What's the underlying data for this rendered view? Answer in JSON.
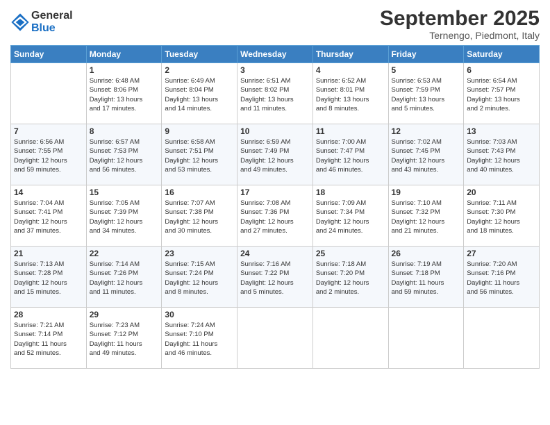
{
  "logo": {
    "general": "General",
    "blue": "Blue"
  },
  "header": {
    "month": "September 2025",
    "location": "Ternengo, Piedmont, Italy"
  },
  "weekdays": [
    "Sunday",
    "Monday",
    "Tuesday",
    "Wednesday",
    "Thursday",
    "Friday",
    "Saturday"
  ],
  "weeks": [
    [
      {
        "day": "",
        "info": ""
      },
      {
        "day": "1",
        "info": "Sunrise: 6:48 AM\nSunset: 8:06 PM\nDaylight: 13 hours\nand 17 minutes."
      },
      {
        "day": "2",
        "info": "Sunrise: 6:49 AM\nSunset: 8:04 PM\nDaylight: 13 hours\nand 14 minutes."
      },
      {
        "day": "3",
        "info": "Sunrise: 6:51 AM\nSunset: 8:02 PM\nDaylight: 13 hours\nand 11 minutes."
      },
      {
        "day": "4",
        "info": "Sunrise: 6:52 AM\nSunset: 8:01 PM\nDaylight: 13 hours\nand 8 minutes."
      },
      {
        "day": "5",
        "info": "Sunrise: 6:53 AM\nSunset: 7:59 PM\nDaylight: 13 hours\nand 5 minutes."
      },
      {
        "day": "6",
        "info": "Sunrise: 6:54 AM\nSunset: 7:57 PM\nDaylight: 13 hours\nand 2 minutes."
      }
    ],
    [
      {
        "day": "7",
        "info": "Sunrise: 6:56 AM\nSunset: 7:55 PM\nDaylight: 12 hours\nand 59 minutes."
      },
      {
        "day": "8",
        "info": "Sunrise: 6:57 AM\nSunset: 7:53 PM\nDaylight: 12 hours\nand 56 minutes."
      },
      {
        "day": "9",
        "info": "Sunrise: 6:58 AM\nSunset: 7:51 PM\nDaylight: 12 hours\nand 53 minutes."
      },
      {
        "day": "10",
        "info": "Sunrise: 6:59 AM\nSunset: 7:49 PM\nDaylight: 12 hours\nand 49 minutes."
      },
      {
        "day": "11",
        "info": "Sunrise: 7:00 AM\nSunset: 7:47 PM\nDaylight: 12 hours\nand 46 minutes."
      },
      {
        "day": "12",
        "info": "Sunrise: 7:02 AM\nSunset: 7:45 PM\nDaylight: 12 hours\nand 43 minutes."
      },
      {
        "day": "13",
        "info": "Sunrise: 7:03 AM\nSunset: 7:43 PM\nDaylight: 12 hours\nand 40 minutes."
      }
    ],
    [
      {
        "day": "14",
        "info": "Sunrise: 7:04 AM\nSunset: 7:41 PM\nDaylight: 12 hours\nand 37 minutes."
      },
      {
        "day": "15",
        "info": "Sunrise: 7:05 AM\nSunset: 7:39 PM\nDaylight: 12 hours\nand 34 minutes."
      },
      {
        "day": "16",
        "info": "Sunrise: 7:07 AM\nSunset: 7:38 PM\nDaylight: 12 hours\nand 30 minutes."
      },
      {
        "day": "17",
        "info": "Sunrise: 7:08 AM\nSunset: 7:36 PM\nDaylight: 12 hours\nand 27 minutes."
      },
      {
        "day": "18",
        "info": "Sunrise: 7:09 AM\nSunset: 7:34 PM\nDaylight: 12 hours\nand 24 minutes."
      },
      {
        "day": "19",
        "info": "Sunrise: 7:10 AM\nSunset: 7:32 PM\nDaylight: 12 hours\nand 21 minutes."
      },
      {
        "day": "20",
        "info": "Sunrise: 7:11 AM\nSunset: 7:30 PM\nDaylight: 12 hours\nand 18 minutes."
      }
    ],
    [
      {
        "day": "21",
        "info": "Sunrise: 7:13 AM\nSunset: 7:28 PM\nDaylight: 12 hours\nand 15 minutes."
      },
      {
        "day": "22",
        "info": "Sunrise: 7:14 AM\nSunset: 7:26 PM\nDaylight: 12 hours\nand 11 minutes."
      },
      {
        "day": "23",
        "info": "Sunrise: 7:15 AM\nSunset: 7:24 PM\nDaylight: 12 hours\nand 8 minutes."
      },
      {
        "day": "24",
        "info": "Sunrise: 7:16 AM\nSunset: 7:22 PM\nDaylight: 12 hours\nand 5 minutes."
      },
      {
        "day": "25",
        "info": "Sunrise: 7:18 AM\nSunset: 7:20 PM\nDaylight: 12 hours\nand 2 minutes."
      },
      {
        "day": "26",
        "info": "Sunrise: 7:19 AM\nSunset: 7:18 PM\nDaylight: 11 hours\nand 59 minutes."
      },
      {
        "day": "27",
        "info": "Sunrise: 7:20 AM\nSunset: 7:16 PM\nDaylight: 11 hours\nand 56 minutes."
      }
    ],
    [
      {
        "day": "28",
        "info": "Sunrise: 7:21 AM\nSunset: 7:14 PM\nDaylight: 11 hours\nand 52 minutes."
      },
      {
        "day": "29",
        "info": "Sunrise: 7:23 AM\nSunset: 7:12 PM\nDaylight: 11 hours\nand 49 minutes."
      },
      {
        "day": "30",
        "info": "Sunrise: 7:24 AM\nSunset: 7:10 PM\nDaylight: 11 hours\nand 46 minutes."
      },
      {
        "day": "",
        "info": ""
      },
      {
        "day": "",
        "info": ""
      },
      {
        "day": "",
        "info": ""
      },
      {
        "day": "",
        "info": ""
      }
    ]
  ]
}
